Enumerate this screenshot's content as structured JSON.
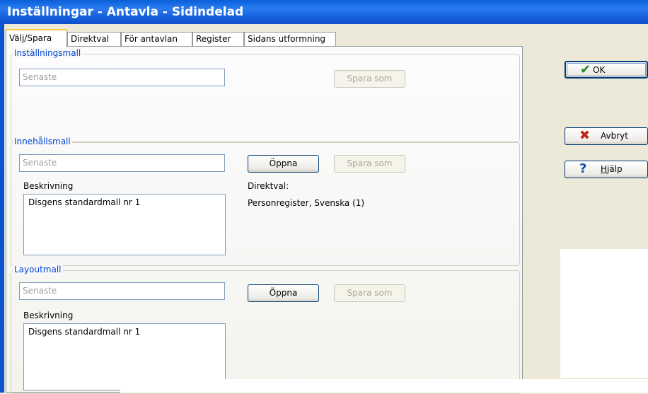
{
  "window": {
    "title": "Inställningar - Antavla - Sidindelad"
  },
  "tabs": [
    "Välj/Spara",
    "Direktval",
    "För antavlan",
    "Register",
    "Sidans utformning"
  ],
  "installningsmall": {
    "legend": "Inställningsmall",
    "placeholder": "Senaste",
    "save_as": "Spara som"
  },
  "innehallsmall": {
    "legend": "Innehållsmall",
    "placeholder": "Senaste",
    "open": "Öppna",
    "save_as": "Spara som",
    "desc_label": "Beskrivning",
    "desc_value": "Disgens standardmall nr 1",
    "direktval_label": "Direktval:",
    "direktval_value": "Personregister, Svenska (1)"
  },
  "layoutmall": {
    "legend": "Layoutmall",
    "placeholder": "Senaste",
    "open": "Öppna",
    "save_as": "Spara som",
    "desc_label": "Beskrivning",
    "desc_value": "Disgens standardmall nr 1"
  },
  "side_buttons": {
    "ok": "OK",
    "cancel": "Avbryt",
    "help": "Hjälp"
  },
  "icons": {
    "ok": "checkmark-icon",
    "cancel": "x-icon",
    "help": "question-icon"
  },
  "colors": {
    "title_bar": "#0a5fd8",
    "accent_text": "#0046d5",
    "check": "#2a8a22",
    "cross": "#c0271a",
    "help": "#1a4fa8"
  }
}
